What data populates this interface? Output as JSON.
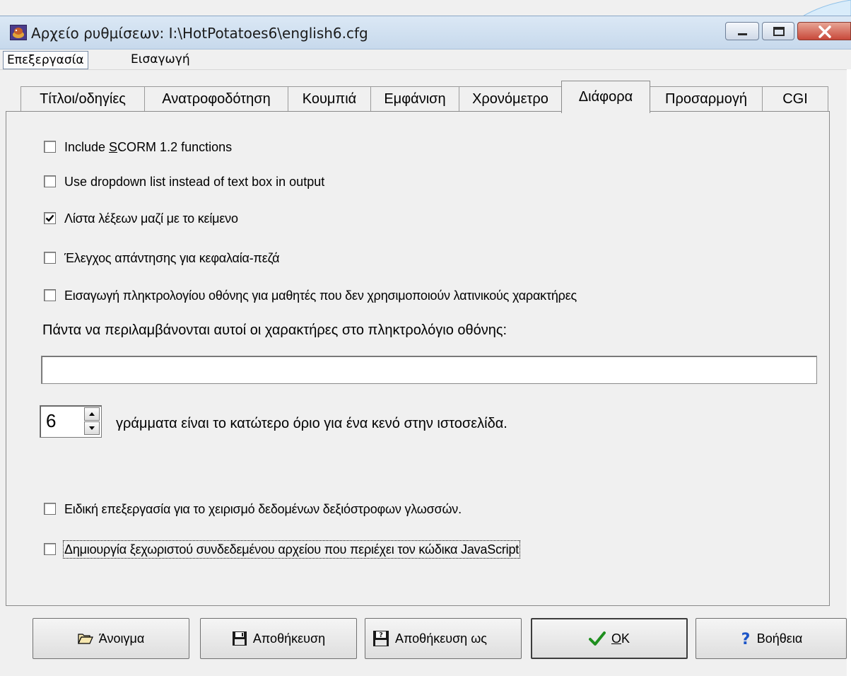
{
  "window": {
    "title": "Αρχείο ρυθμίσεων:  I:\\HotPotatoes6\\english6.cfg",
    "controls": {
      "minimize_icon": "minimize-icon",
      "maximize_icon": "maximize-icon",
      "close_icon": "close-icon"
    }
  },
  "menu": {
    "items": [
      {
        "label": "Επεξεργασία"
      },
      {
        "label": "Εισαγωγή"
      }
    ]
  },
  "tabs": [
    {
      "label": "Τίτλοι/οδηγίες",
      "active": false
    },
    {
      "label": "Ανατροφοδότηση",
      "active": false
    },
    {
      "label": "Κουμπιά",
      "active": false
    },
    {
      "label": "Εμφάνιση",
      "active": false
    },
    {
      "label": "Χρονόμετρο",
      "active": false
    },
    {
      "label": "Διάφορα",
      "active": true
    },
    {
      "label": "Προσαρμογή",
      "active": false
    },
    {
      "label": "CGI",
      "active": false
    }
  ],
  "options": [
    {
      "label_pre": "Include ",
      "label_mn": "S",
      "label_post": "CORM 1.2 functions",
      "checked": false
    },
    {
      "label": "Use dropdown list instead of text box in output",
      "checked": false
    },
    {
      "label": "Λίστα λέξεων μαζί με το κείμενο",
      "checked": true
    },
    {
      "label": "Έλεγχος απάντησης για κεφαλαία-πεζά",
      "checked": false
    },
    {
      "label": "Εισαγωγή πληκτρολογίου οθόνης για μαθητές που δεν χρησιμοποιούν λατινικούς χαρακτήρες",
      "checked": false
    }
  ],
  "keyboard_chars": {
    "label": "Πάντα να περιλαμβάνονται αυτοί οι χαρακτήρες στο πληκτρολόγιο οθόνης:",
    "value": ""
  },
  "min_gap": {
    "value": "6",
    "label": "γράμματα είναι το κατώτερο όριο για ένα κενό στην ιστοσελίδα."
  },
  "options_lower": [
    {
      "label": "Ειδική επεξεργασία για το χειρισμό δεδομένων δεξιόστροφων γλωσσών.",
      "checked": false
    },
    {
      "label": "Δημιουργία ξεχωριστού συνδεδεμένου αρχείου που περιέχει τον κώδικα JavaScript",
      "checked": false
    }
  ],
  "buttons": {
    "open": {
      "label": "Άνοιγμα",
      "icon": "folder-open-icon"
    },
    "save": {
      "label": "Αποθήκευση",
      "icon": "floppy-disk-icon"
    },
    "save_as": {
      "label": "Αποθήκευση ως",
      "icon": "floppy-save-as-icon"
    },
    "ok": {
      "label_mn": "O",
      "label_post": "K",
      "icon": "checkmark-icon"
    },
    "help": {
      "label": "Βοήθεια",
      "icon": "question-mark-icon"
    }
  },
  "colors": {
    "ok_check": "#1f8f1f",
    "help_mark": "#1d56c8",
    "close_button": "#c8483a"
  }
}
